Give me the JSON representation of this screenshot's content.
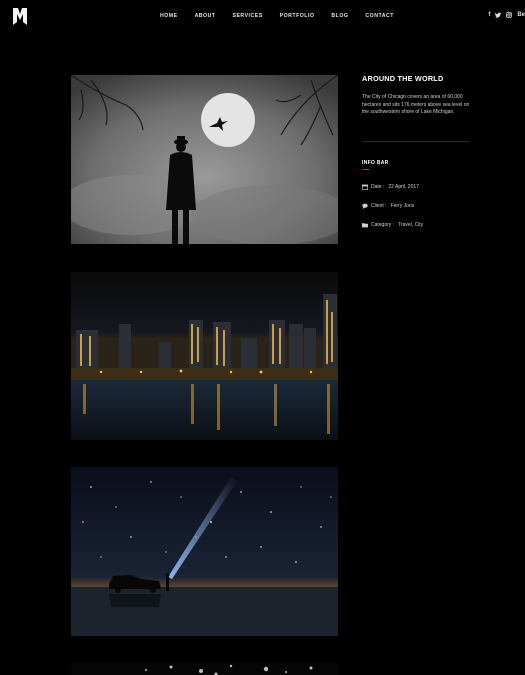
{
  "nav": {
    "items": [
      "HOME",
      "ABOUT",
      "SERVICES",
      "PORTFOLIO",
      "BLOG",
      "CONTACT"
    ]
  },
  "social": {
    "facebook": "f",
    "twitter": "t",
    "instagram": "ig",
    "behance": "Be"
  },
  "sidebar": {
    "title": "AROUND THE WORLD",
    "description": "The City of Chicago covers an area of 60,000 hectares and sits 176 meters above sea level on the southwestern shore of Lake Michigan.",
    "info_title": "INFO BAR",
    "info": [
      {
        "label": "Date :",
        "value": "22 April, 2017",
        "icon": "calendar-icon"
      },
      {
        "label": "Client :",
        "value": "Ferry Jons",
        "icon": "chat-icon"
      },
      {
        "label": "Category :",
        "value": "Travel, City",
        "icon": "folder-icon"
      }
    ]
  },
  "colors": {
    "background": "#000000",
    "accent": "#c9302c",
    "text": "#ffffff",
    "muted_text": "#cfcfcf"
  },
  "gallery": {
    "images": [
      "man-in-fog-moon",
      "city-skyline-night",
      "starry-night-car"
    ]
  }
}
